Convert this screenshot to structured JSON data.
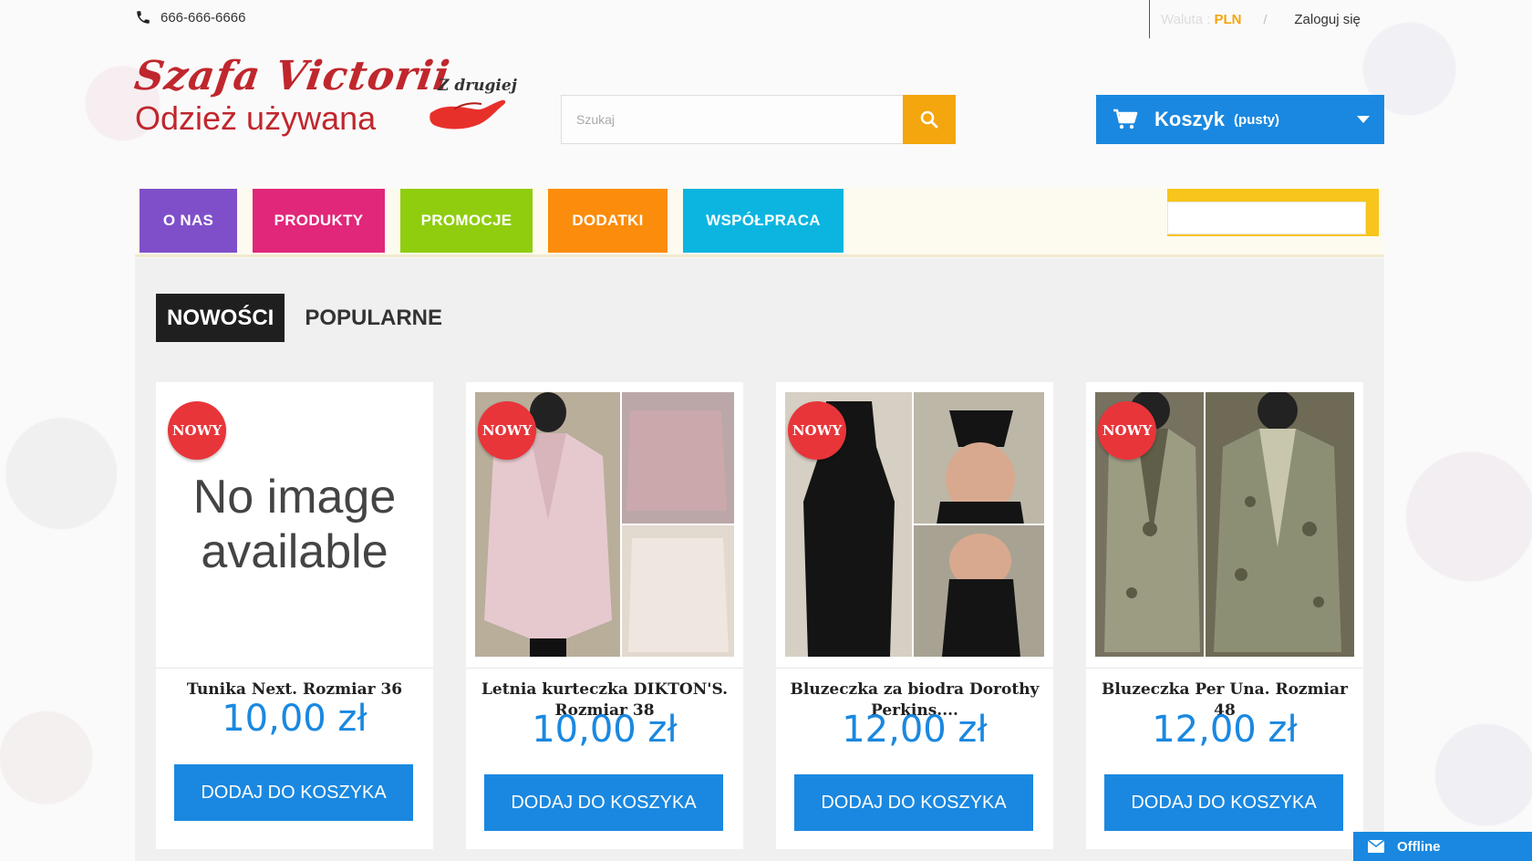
{
  "topbar": {
    "phone": "666-666-6666",
    "currency_label": "Waluta :",
    "currency_value": "PLN",
    "login": "Zaloguj się"
  },
  "logo": {
    "title": "Szafa Victorii",
    "subtitle": "Odzież używana",
    "mark_text": "Z drugiej"
  },
  "search": {
    "placeholder": "Szukaj"
  },
  "cart": {
    "label": "Koszyk",
    "status": "(pusty)"
  },
  "nav": {
    "items": [
      {
        "label": "O NAS",
        "color": "#7f4fc9"
      },
      {
        "label": "PRODUKTY",
        "color": "#e0277a"
      },
      {
        "label": "PROMOCJE",
        "color": "#8fcd0e"
      },
      {
        "label": "DODATKI",
        "color": "#fb8c0c"
      },
      {
        "label": "WSPÓŁPRACA",
        "color": "#0bb5e0"
      }
    ]
  },
  "tabs": {
    "active": "NOWOŚCI",
    "inactive": "POPULARNE"
  },
  "products": [
    {
      "badge": "NOWY",
      "name": "Tunika Next. Rozmiar 36",
      "price": "10,00 zł",
      "button": "DODAJ DO KOSZYKA",
      "no_image_line1": "No image",
      "no_image_line2": "available"
    },
    {
      "badge": "NOWY",
      "name": "Letnia kurteczka DIKTON'S. Rozmiar 38",
      "price": "10,00 zł",
      "button": "DODAJ DO KOSZYKA"
    },
    {
      "badge": "NOWY",
      "name": "Bluzeczka za biodra Dorothy Perkins....",
      "price": "12,00 zł",
      "button": "DODAJ DO KOSZYKA"
    },
    {
      "badge": "NOWY",
      "name": "Bluzeczka Per Una. Rozmiar 48",
      "price": "12,00 zł",
      "button": "DODAJ DO KOSZYKA"
    }
  ],
  "chat": {
    "label": "Offline"
  }
}
